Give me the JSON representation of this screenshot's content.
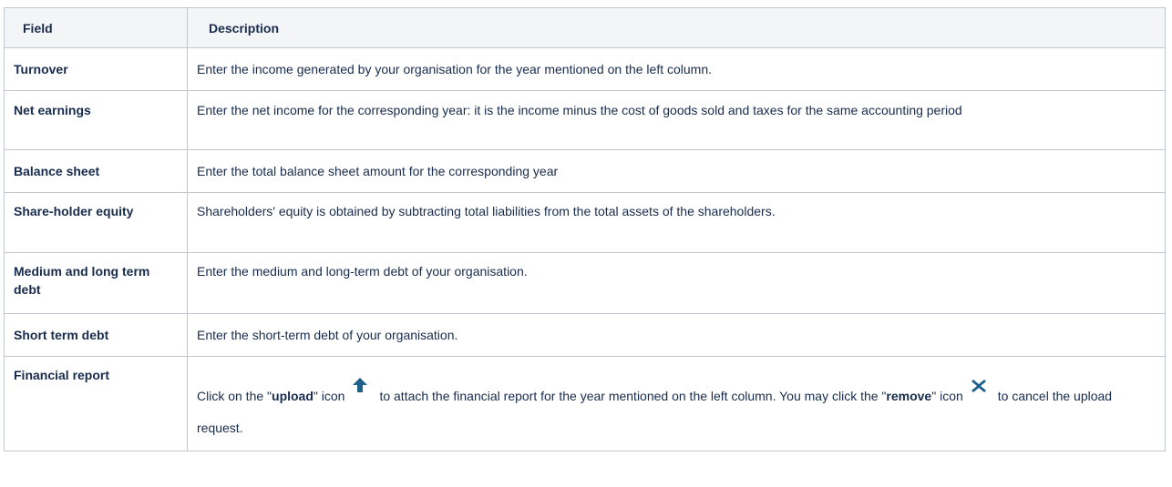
{
  "table": {
    "headers": {
      "field": "Field",
      "description": "Description"
    },
    "rows": [
      {
        "field": "Turnover",
        "description": "Enter the income generated by your organisation for the year mentioned on the left column."
      },
      {
        "field": "Net earnings",
        "description": "Enter the net income for the corresponding year: it is the income minus the cost of goods sold and taxes for the same accounting period"
      },
      {
        "field": "Balance sheet",
        "description": "Enter the total balance sheet amount for the corresponding year"
      },
      {
        "field": "Share-holder equity",
        "description": "Shareholders' equity is obtained by subtracting total liabilities from the total assets of the shareholders."
      },
      {
        "field": "Medium and long term debt",
        "description": "Enter the medium and long-term debt of your organisation."
      },
      {
        "field": "Short term debt",
        "description": "Enter the short-term debt of your organisation."
      },
      {
        "field": "Financial report",
        "description_parts": {
          "p1": "Click on the \"",
          "upload_kw": "upload",
          "p2": "\" icon",
          "p3": "to attach the financial report for the year mentioned on the left column. You may click the \"",
          "remove_kw": "remove",
          "p4": "\" icon",
          "p5": "to cancel the upload request."
        }
      }
    ]
  },
  "icons": {
    "upload": {
      "name": "arrow-up-icon",
      "color": "#1f5f8b"
    },
    "remove": {
      "name": "x-icon",
      "color": "#1f5f8b"
    }
  },
  "colors": {
    "border": "#c1c7d0",
    "header_bg": "#f4f5f7",
    "text": "#172b4d"
  }
}
